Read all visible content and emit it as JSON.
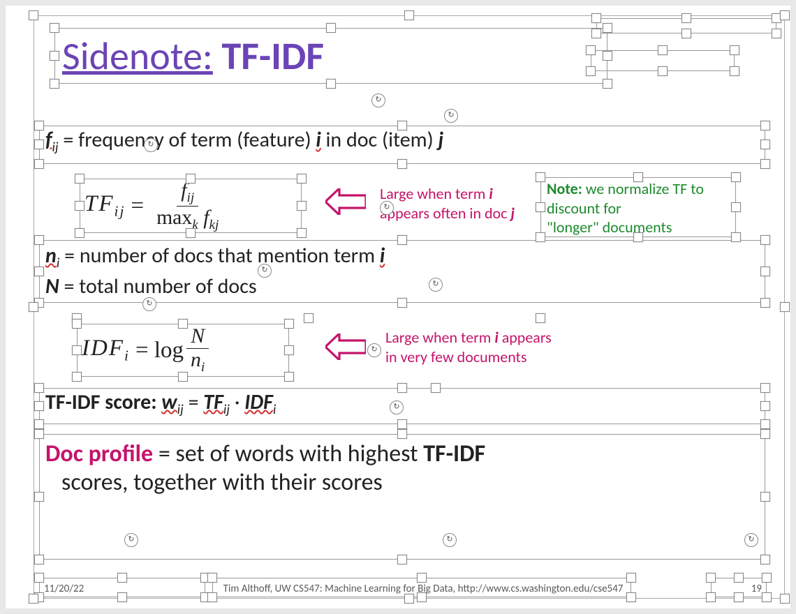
{
  "title": {
    "sidenote_label": "Sidenote:",
    "tfidf_label": "TF-IDF"
  },
  "line_fij": {
    "lhs": "f",
    "sub": "ij",
    "text": " = frequency of term (feature) ",
    "i": "i",
    "mid": " in doc (item) ",
    "j": "j"
  },
  "eq_tf": {
    "lhs": "TF",
    "lhs_sub": "ij",
    "eq": " = ",
    "num": "f",
    "num_sub": "ij",
    "den_pre": "max",
    "den_sub": "k",
    "den_f": " f",
    "den_f_sub": "kj"
  },
  "tf_note": {
    "l1": "Large when term ",
    "i": "i",
    "l2": "appears often in doc ",
    "j": "j"
  },
  "normalize_note": {
    "bold": "Note:",
    "l1": " we normalize TF to discount for",
    "l2": "\"longer\" documents"
  },
  "line_ni": {
    "lhs": "n",
    "sub": "i",
    "text": " = number of docs that mention term ",
    "i": "i"
  },
  "line_N": {
    "lhs": "N",
    "text": " = total number of docs"
  },
  "eq_idf": {
    "lhs": "IDF",
    "lhs_sub": "i",
    "eq": " = log ",
    "num": "N",
    "den": "n",
    "den_sub": "i"
  },
  "idf_note": {
    "l1": "Large when term ",
    "i": "i",
    "l1b": " appears",
    "l2": "in very few documents"
  },
  "score_line": {
    "pre": "TF-IDF score:  ",
    "w": "w",
    "w_sub": "ij",
    "eq": " = ",
    "tf": "TF",
    "tf_sub": "ij",
    "op": " · ",
    "idf": "IDF",
    "idf_sub": "i"
  },
  "doc_profile": {
    "bold_pink": "Doc profile",
    "eq": " = set of words with highest ",
    "bold": "TF-IDF",
    "rest": " scores, together with their scores"
  },
  "footer": {
    "date": "11/20/22",
    "credit": "Tim Althoff, UW CS547: Machine Learning for Big Data, http://www.cs.washington.edu/cse547",
    "page": "19"
  }
}
